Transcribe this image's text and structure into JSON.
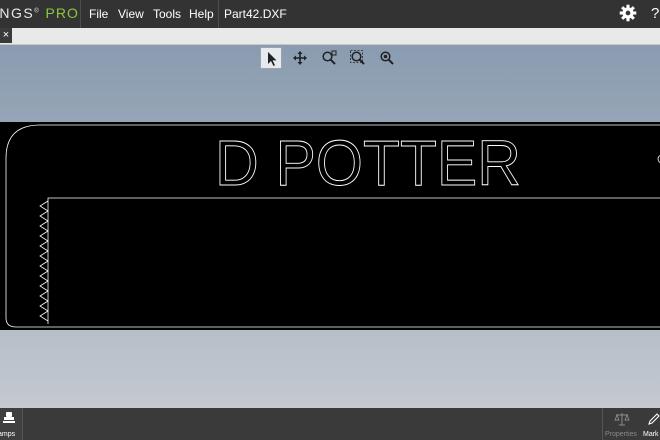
{
  "app": {
    "logo_main": "INGS",
    "logo_reg": "®",
    "logo_pro": "PRO"
  },
  "menu": {
    "items": [
      "File",
      "View",
      "Tools",
      "Help"
    ],
    "file_name": "Part42.DXF",
    "help_label": "?"
  },
  "tabs": {
    "close_label": "×"
  },
  "toolbar": {
    "tools": [
      "select-icon",
      "pan-icon",
      "zoom-window-icon",
      "zoom-fit-icon",
      "zoom-extents-icon"
    ],
    "active": "select-icon"
  },
  "drawing": {
    "text": "D POTTER"
  },
  "bottom": {
    "stamps_label": "amps",
    "properties_label": "Properties",
    "mark_label": "Mark"
  },
  "colors": {
    "menubar": "#333333",
    "accent_pro": "#8dc63f",
    "drawing_bg": "#000000",
    "drawing_line": "#ffffff"
  }
}
